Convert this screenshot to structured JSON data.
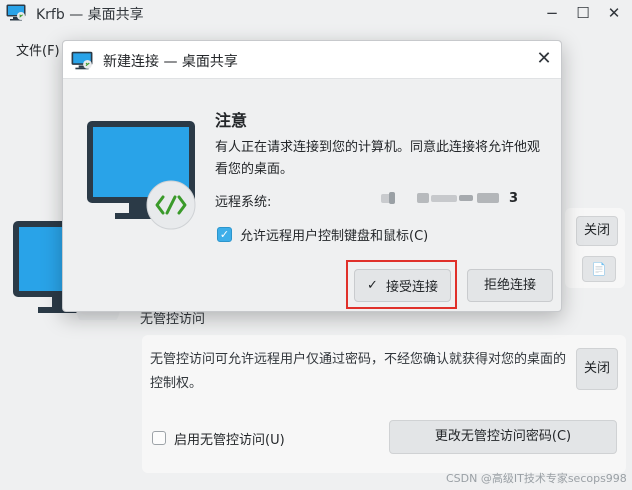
{
  "window": {
    "title": "Krfb — 桌面共享",
    "minimize_glyph": "−",
    "maximize_glyph": "☐",
    "close_glyph": "✕"
  },
  "menu": {
    "file": "文件(F)"
  },
  "main": {
    "right_close": "关闭",
    "doc_icon": "📄",
    "unattended_label": "无管控访问",
    "unattended_desc": "无管控访问可允许远程用户仅通过密码，不经您确认就获得对您的桌面的控制权。",
    "unattended_close": "关闭",
    "enable_unattended": "启用无管控访问(U)",
    "enable_checked": false,
    "change_password": "更改无管控访问密码(C)"
  },
  "dialog": {
    "title": "新建连接 — 桌面共享",
    "close_glyph": "✕",
    "notice_title": "注意",
    "notice_text": "有人正在请求连接到您的计算机。同意此连接将允许他观看您的桌面。",
    "remote_label": "远程系统:",
    "remote_suffix": "3",
    "allow_control": "允许远程用户控制键盘和鼠标(C)",
    "allow_checked": true,
    "checkmark": "✓",
    "accept_check": "✓",
    "accept": "接受连接",
    "reject": "拒绝连接"
  },
  "icons": {
    "app_icon": "monitor-share-icon",
    "monitor": "monitor-remote-icon"
  },
  "colors": {
    "monitor_screen": "#29a3e8",
    "arrows": "#3a9a2a",
    "highlight": "#e0302a",
    "checkbox_checked": "#3daee9"
  },
  "watermark": "CSDN @高级IT技术专家secops998"
}
